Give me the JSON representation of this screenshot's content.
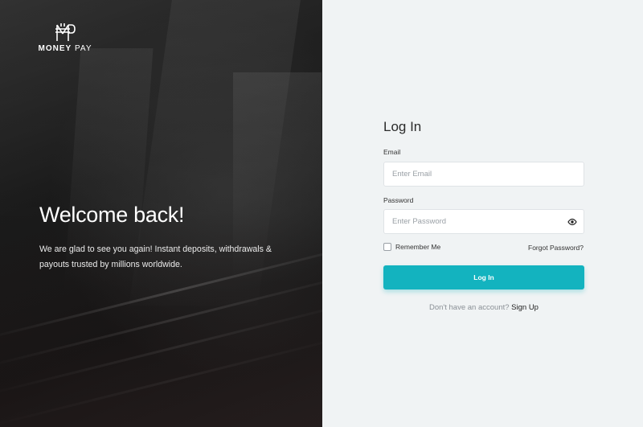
{
  "brand": {
    "name_bold": "MONEY",
    "name_light": " PAY"
  },
  "hero": {
    "title": "Welcome back!",
    "text": "We are glad to see you again! Instant deposits, withdrawals & payouts trusted by millions worldwide."
  },
  "login": {
    "title": "Log In",
    "email_label": "Email",
    "email_placeholder": "Enter Email",
    "email_value": "",
    "password_label": "Password",
    "password_placeholder": "Enter Password",
    "password_value": "",
    "remember_label": "Remember Me",
    "remember_checked": false,
    "forgot_label": "Forgot Password?",
    "button_label": "Log In",
    "signup_prompt": "Don't have an account?",
    "signup_link": "Sign Up"
  },
  "icons": {
    "logo": "money-pay-logo-icon",
    "password_toggle": "eye-icon"
  },
  "colors": {
    "accent": "#13b3bf",
    "panel_bg": "#f0f3f4",
    "hero_bg": "#1c1c1c"
  }
}
